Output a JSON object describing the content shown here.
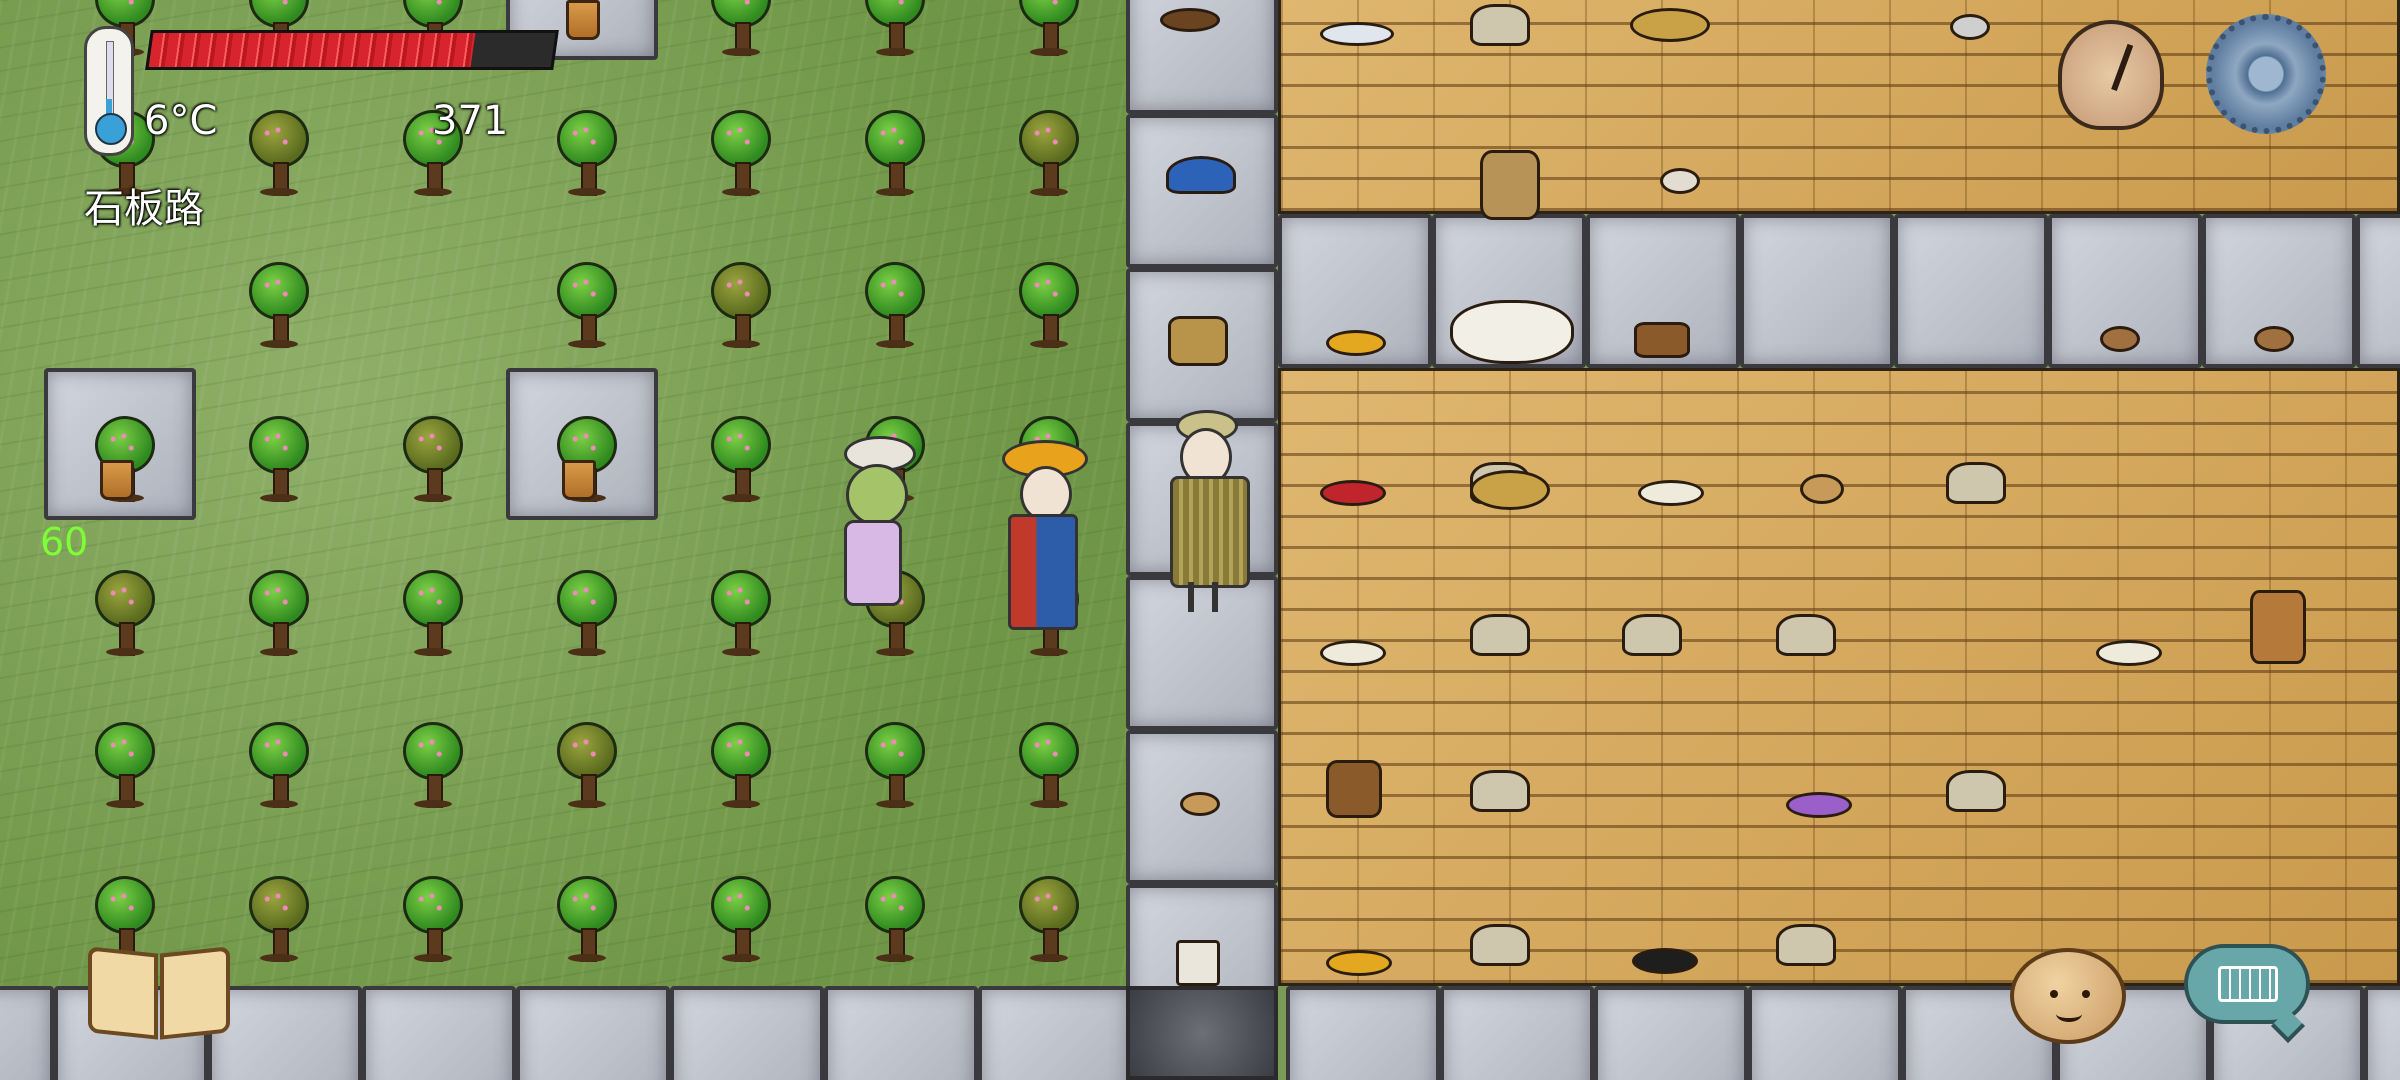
{
  "hud": {
    "temperature": "6°C",
    "score": "371",
    "location": "石板路",
    "fps": "60",
    "health_fraction": 0.8
  },
  "colors": {
    "grass": "#7a9a55",
    "stone": "#c0c3cc",
    "wood_floor": "#d6a95e",
    "health_red": "#d8242c",
    "fps_green": "#7cff36"
  },
  "icons": {
    "thermometer": "thermometer-icon",
    "health": "health-bar",
    "clock": "clock-icon",
    "settings": "gear-icon",
    "journal": "book-icon",
    "emote": "emote-face-icon",
    "keyboard": "keyboard-icon"
  },
  "scene": {
    "tree_rows": 6,
    "tree_columns": 7,
    "characters": [
      "player-yellow-hat",
      "npc-white-hat",
      "npc-grass-cape"
    ],
    "floor_items": [
      "basket",
      "bowl",
      "pile",
      "rabbit-trap",
      "water-bucket",
      "wool",
      "clothing"
    ]
  }
}
